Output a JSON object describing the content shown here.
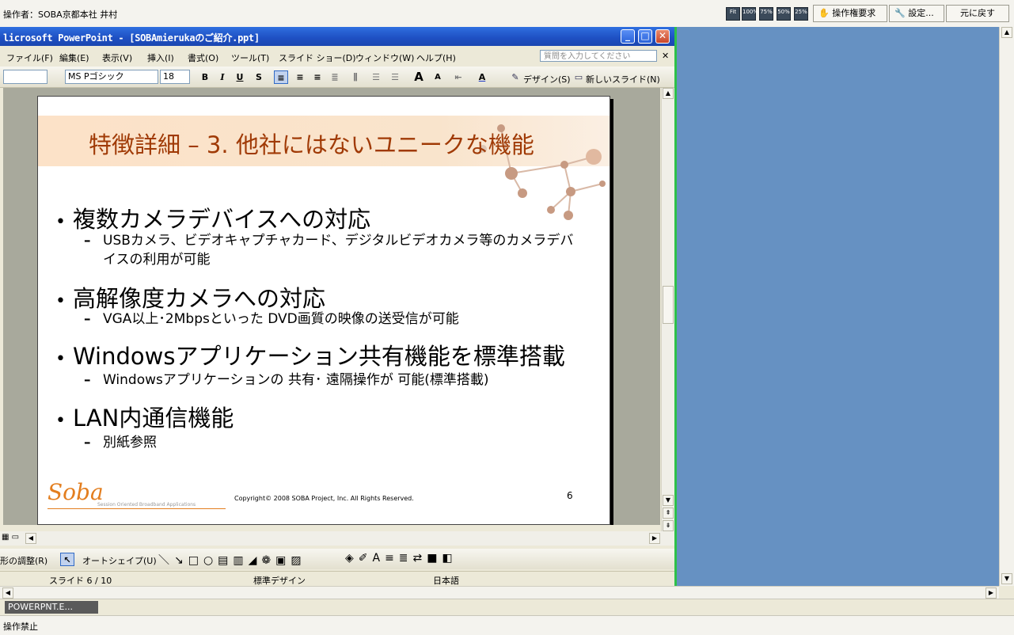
{
  "operator_bar": {
    "operator_text": "操作者：SOBA京都本社 井村",
    "zoom_buttons": [
      "Fit",
      "100%",
      "75%",
      "50%",
      "25%"
    ],
    "request_label": "操作権要求",
    "settings_label": "設定...",
    "back_label": "元に戻す"
  },
  "window": {
    "title": "licrosoft PowerPoint - [SOBAmierukaのご紹介.ppt]"
  },
  "menu": {
    "items": [
      "ファイル(F)",
      "編集(E)",
      "表示(V)",
      "挿入(I)",
      "書式(O)",
      "ツール(T)",
      "スライド ショー(D)",
      "ウィンドウ(W)",
      "ヘルプ(H)"
    ],
    "question_placeholder": "質問を入力してください"
  },
  "format_bar": {
    "font_name": "MS Pゴシック",
    "font_size": "18",
    "design_label": "デザイン(S)",
    "new_slide_label": "新しいスライド(N)"
  },
  "slide": {
    "title": "特徴詳細 – 3. 他社にはないユニークな機能",
    "bullets": [
      {
        "text": "複数カメラデバイスへの対応",
        "sub": [
          "USBカメラ、ビデオキャプチャカード、デジタルビデオカメラ等のカメラデバ",
          "イスの利用が可能"
        ]
      },
      {
        "text": "高解像度カメラへの対応",
        "sub": [
          "VGA以上･2Mbpsといった DVD画質の映像の送受信が可能"
        ]
      },
      {
        "text": "Windowsアプリケーション共有機能を標準搭載",
        "sub": [
          "Windowsアプリケーションの 共有･ 遠隔操作が 可能(標準搭載)"
        ]
      },
      {
        "text": "LAN内通信機能",
        "sub": [
          "別紙参照"
        ]
      }
    ],
    "logo_text": "Soba",
    "logo_subtext": "Session Oriented Broadband Applications",
    "copyright": "Copyright© 2008 SOBA Project, Inc. All Rights Reserved.",
    "page_number": "6"
  },
  "draw_bar": {
    "adjust_label": "形の調整(R)",
    "autoshape_label": "オートシェイプ(U)"
  },
  "status": {
    "slide_pos": "スライド 6 / 10",
    "template": "標準デザイン",
    "language": "日本語"
  },
  "taskbar": {
    "item": "POWERPNT.E..."
  },
  "bottom_status": {
    "text": "操作禁止"
  },
  "colors": {
    "title_bar": "#2f6fe0",
    "slide_title": "#a03a06",
    "title_band": "#fce2c8",
    "right_pane": "#6691c2",
    "divider_green": "#2ec04a"
  }
}
